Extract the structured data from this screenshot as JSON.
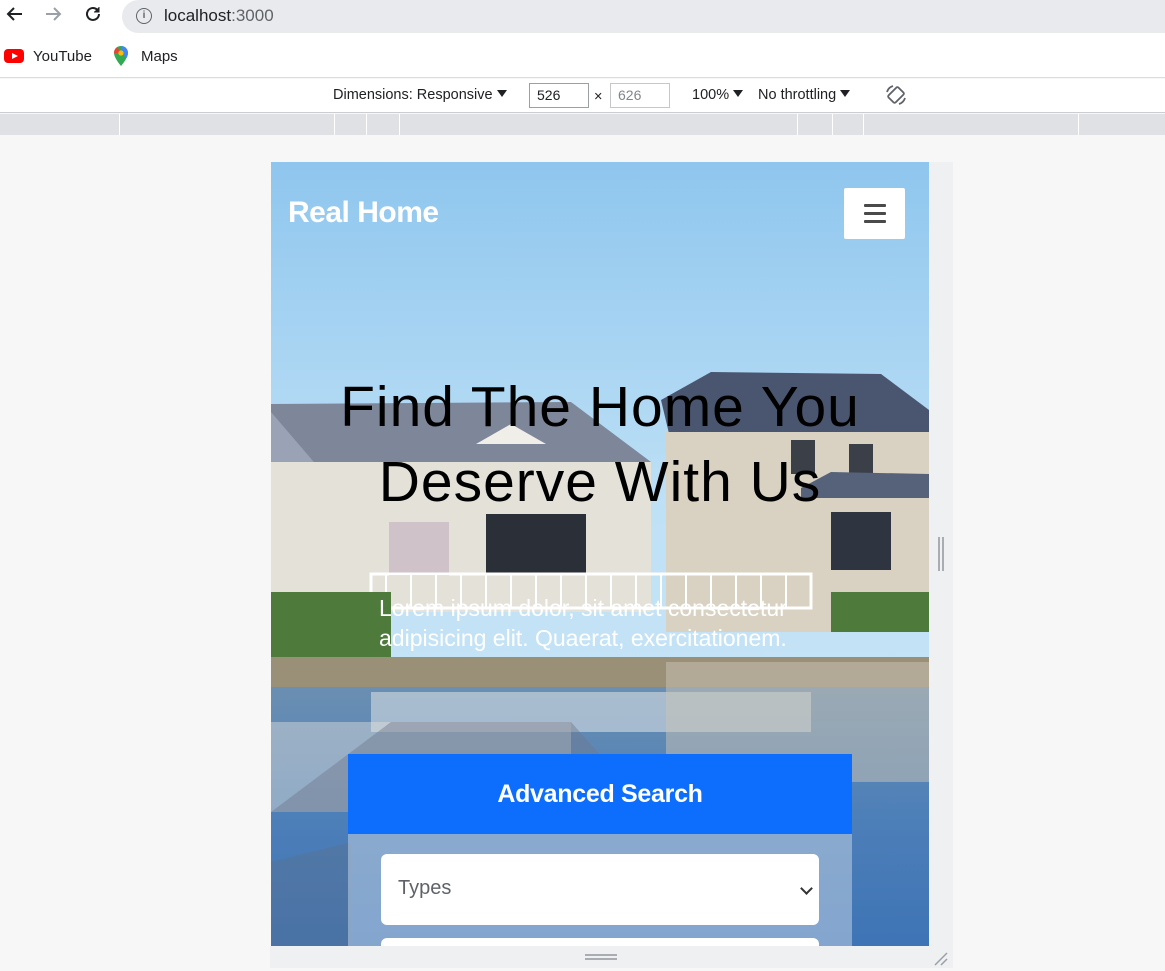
{
  "browser": {
    "url_host": "localhost",
    "url_port": ":3000",
    "bookmarks": [
      {
        "label": "YouTube",
        "icon": "youtube-icon"
      },
      {
        "label": "Maps",
        "icon": "maps-icon"
      }
    ]
  },
  "devtools": {
    "dimensions_label": "Dimensions: Responsive",
    "width_value": "526",
    "times": "×",
    "height_value": "626",
    "zoom_label": "100%",
    "throttling_label": "No throttling"
  },
  "site": {
    "brand": "Real Home",
    "headline": "Find The Home You Deserve With Us",
    "subtext": "Lorem ipsum dolor, sit amet consectetur adipisicing elit. Quaerat, exercitationem.",
    "search_title": "Advanced Search",
    "types_select": "Types"
  },
  "colors": {
    "accent": "#0d6efd",
    "brand_text": "#ffffff"
  }
}
